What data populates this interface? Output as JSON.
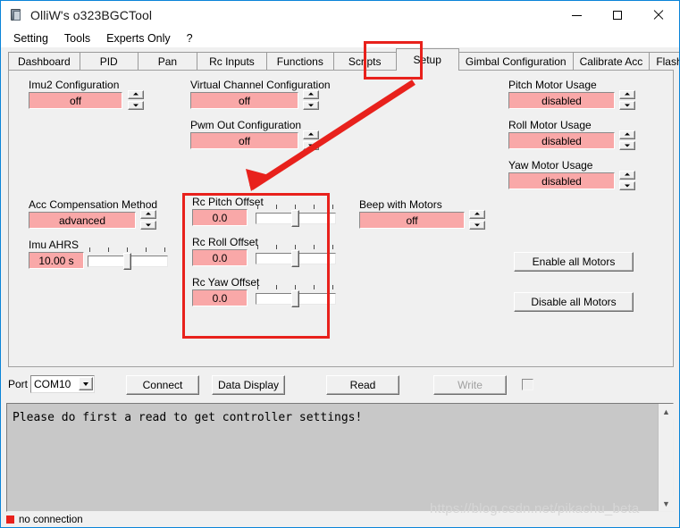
{
  "window": {
    "title": "OlliW's o323BGCTool",
    "icon": "app-icon",
    "controls": {
      "minimize": "minimize",
      "maximize": "maximize",
      "close": "close"
    }
  },
  "menubar": {
    "items": [
      "Setting",
      "Tools",
      "Experts Only",
      "?"
    ]
  },
  "tabs": {
    "items": [
      {
        "label": "Dashboard",
        "selected": false
      },
      {
        "label": "PID",
        "selected": false
      },
      {
        "label": "Pan",
        "selected": false
      },
      {
        "label": "Rc Inputs",
        "selected": false
      },
      {
        "label": "Functions",
        "selected": false
      },
      {
        "label": "Scripts",
        "selected": false
      },
      {
        "label": "Setup",
        "selected": true
      },
      {
        "label": "Gimbal Configuration",
        "selected": false
      },
      {
        "label": "Calibrate Acc",
        "selected": false
      },
      {
        "label": "Flash Firmware",
        "selected": false
      }
    ]
  },
  "setup": {
    "imu2_configuration": {
      "label": "Imu2 Configuration",
      "value": "off"
    },
    "virtual_channel_configuration": {
      "label": "Virtual Channel Configuration",
      "value": "off"
    },
    "pwm_out_configuration": {
      "label": "Pwm Out Configuration",
      "value": "off"
    },
    "pitch_motor_usage": {
      "label": "Pitch Motor Usage",
      "value": "disabled"
    },
    "roll_motor_usage": {
      "label": "Roll Motor Usage",
      "value": "disabled"
    },
    "yaw_motor_usage": {
      "label": "Yaw Motor Usage",
      "value": "disabled"
    },
    "acc_compensation_method": {
      "label": "Acc Compensation Method",
      "value": "advanced"
    },
    "imu_ahrs": {
      "label": "Imu AHRS",
      "value": "10.00 s"
    },
    "rc_pitch_offset": {
      "label": "Rc Pitch Offset",
      "value": "0.0"
    },
    "rc_roll_offset": {
      "label": "Rc Roll Offset",
      "value": "0.0"
    },
    "rc_yaw_offset": {
      "label": "Rc Yaw Offset",
      "value": "0.0"
    },
    "beep_with_motors": {
      "label": "Beep with Motors",
      "value": "off"
    },
    "enable_all_motors": "Enable all Motors",
    "disable_all_motors": "Disable all Motors"
  },
  "toolbar": {
    "port_label": "Port",
    "port_value": "COM10",
    "connect": "Connect",
    "data_display": "Data Display",
    "read": "Read",
    "write": "Write",
    "write_disabled": true,
    "checkbox_checked": false
  },
  "log": {
    "text": "Please do first a read to get controller settings!"
  },
  "statusbar": {
    "text": "no connection",
    "led_color": "#e8211c"
  },
  "watermark": {
    "text": "https://blog.csdn.net/pikachu_beta"
  },
  "annotations": {
    "highlight_color": "#e8211c",
    "setup_tab_box": "Setup",
    "rc_offsets_box": "Rc Offsets group"
  }
}
